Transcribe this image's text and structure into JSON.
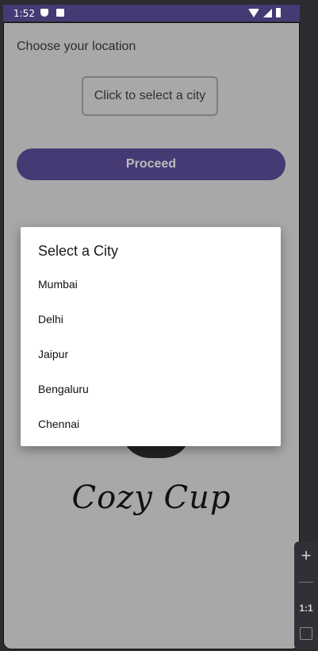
{
  "status_bar": {
    "time": "1:52",
    "icons": [
      "shield-icon",
      "accessibility-icon",
      "wifi-icon",
      "signal-icon",
      "battery-icon"
    ]
  },
  "screen": {
    "choose_label": "Choose your location",
    "city_select_label": "Click to select a city",
    "proceed_label": "Proceed",
    "brand_name": "Cozy Cup"
  },
  "dialog": {
    "title": "Select a City",
    "cities": [
      "Mumbai",
      "Delhi",
      "Jaipur",
      "Bengaluru",
      "Chennai"
    ]
  },
  "emulator_tools": {
    "zoom_in": "+",
    "zoom_out": "—",
    "actual_size": "1:1"
  },
  "colors": {
    "accent": "#463a74",
    "scrim": "#a8a8a8",
    "dialog_bg": "#ffffff"
  }
}
